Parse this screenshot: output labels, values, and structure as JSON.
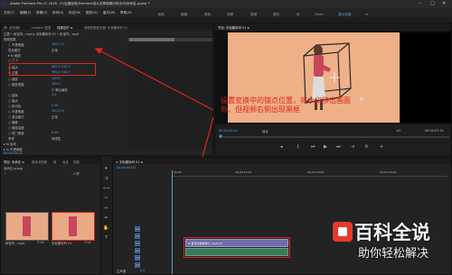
{
  "window": {
    "title": "Adobe Premiere Pro CC 2018 - E:\\百度经验\\Premiere怎么去掉视频中的水印\\未命名.prproj *"
  },
  "menu": [
    "文件(F)",
    "编辑(E)",
    "剪辑(C)",
    "序列(S)",
    "标记(M)",
    "图形(G)",
    "窗口(W)",
    "帮助(H)"
  ],
  "workspaces": [
    "组件",
    "编辑",
    "颜色",
    "效果",
    "音频",
    "图形",
    "库",
    "Titles",
    "显示全部",
    "≫"
  ],
  "left_tabs": [
    "源: (无剪辑)",
    "Lumetri 范围",
    "效果控件 ≡",
    "音频剪辑混合器: 无标题序列 01"
  ],
  "effect_controls": {
    "header": "主要 • 卧室内...mp4 ▸ 无标题序列 01 • 卧室内...mp4",
    "sections": [
      "视频效果",
      "▸ fx 运动",
      "▸ fx 不透明度",
      "▸ 时间重映射"
    ],
    "rows": [
      {
        "label": "○ 不透明度",
        "value": "100.0 %"
      },
      {
        "label": "混合模式",
        "value": "正常"
      },
      {
        "label": "▾ fx 裁剪",
        "value": ""
      },
      {
        "label": "○ □ ✐",
        "value": ""
      },
      {
        "label": "○ 锚点",
        "value": "960.0    540.0"
      },
      {
        "label": "○ 位置",
        "value": "960.0    540.0"
      },
      {
        "label": "○ 缩放",
        "value": "100.0"
      },
      {
        "label": "○ 缩放宽度",
        "value": "100.0"
      },
      {
        "label": "",
        "value": "☑ 等比缩放"
      },
      {
        "label": "○ 旋转",
        "value": "0.0"
      },
      {
        "label": "○ 锚点",
        "value": ""
      },
      {
        "label": "○ 防闪烁",
        "value": "0.00"
      },
      {
        "label": "○ 不透明度",
        "value": "100.0 %"
      },
      {
        "label": "○ 混合模式",
        "value": "正常"
      },
      {
        "label": "○ 偏移",
        "value": ""
      },
      {
        "label": "○ 缩放高度",
        "value": ""
      },
      {
        "label": "○ 快门角度",
        "value": "0.00"
      },
      {
        "label": "采样",
        "value": "双线性"
      }
    ],
    "bottom_rows": [
      "○ 不透明度",
      "○ 不透明度"
    ],
    "timecode": "00:00:00:00"
  },
  "program": {
    "tab": "节目: 无标题序列 01 ≡",
    "timecode_left": "00:00:00:00",
    "fit": "适合",
    "quality": "1/2",
    "timecode_right": "00:00:07:14"
  },
  "project": {
    "tabs": [
      "项目: 未命名 ≡",
      "媒体浏览器",
      "库",
      "信息",
      "效果"
    ],
    "path": "未命名.prproj",
    "item_count": "2 项",
    "items": [
      {
        "name": "卧室内...mp4",
        "duration": "7:14"
      },
      {
        "name": "无标题序列 01",
        "duration": "7:14"
      }
    ]
  },
  "timeline": {
    "tab": "× 无标题序列 01 ≡",
    "timecode": "00:00:00:00",
    "ruler": [
      "00:00",
      "00:00:15:00",
      "00:00:30:00",
      "00:00:45:00"
    ],
    "tracks": [
      "V3",
      "V2",
      "V1",
      "A1",
      "A2",
      "A3"
    ],
    "clip_label": "fx 卧室内的模特儿.mp4 [V]",
    "master_label": "主声道",
    "master_value": "0.0"
  },
  "annotation": {
    "text": "设置变换中的锚点位置，将水印移出画面外，但视频右侧出现黑框"
  },
  "watermark": {
    "brand": "百科全说",
    "sub": "助你轻松解决"
  }
}
